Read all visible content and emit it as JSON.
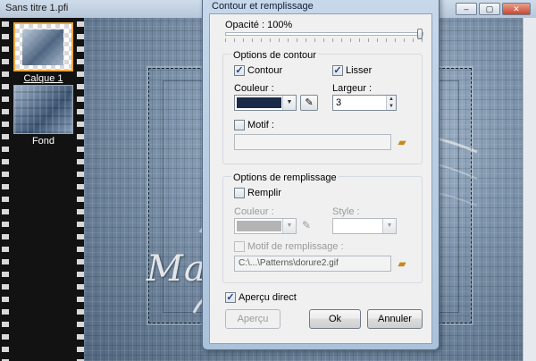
{
  "doc_window": {
    "title": "Sans titre 1.pfi",
    "buttons": {
      "minimize": "–",
      "maximize": "▢",
      "close": "✕"
    }
  },
  "layers": [
    {
      "name": "Calque 1",
      "selected": true
    },
    {
      "name": "Fond",
      "selected": false
    }
  ],
  "watermark": {
    "text": "Manany"
  },
  "dialog": {
    "title": "Contour et remplissage",
    "opacity_label": "Opacité : 100%",
    "opacity_value": 100,
    "stroke_group": {
      "title": "Options de contour",
      "contour_label": "Contour",
      "contour_checked": true,
      "smooth_label": "Lisser",
      "smooth_checked": true,
      "color_label": "Couleur :",
      "color": "#1a2a48",
      "width_label": "Largeur :",
      "width_value": "3",
      "pattern_label": "Motif :",
      "pattern_checked": false,
      "pattern_path": ""
    },
    "fill_group": {
      "title": "Options de remplissage",
      "fill_label": "Remplir",
      "fill_checked": false,
      "color_label": "Couleur :",
      "color": "#b4b4b4",
      "style_label": "Style :",
      "fill_pattern_label": "Motif de remplissage :",
      "fill_pattern_path": "C:\\...\\Patterns\\dorure2.gif"
    },
    "preview_label": "Aperçu direct",
    "preview_checked": true,
    "buttons": {
      "preview": "Aperçu",
      "ok": "Ok",
      "cancel": "Annuler"
    }
  }
}
